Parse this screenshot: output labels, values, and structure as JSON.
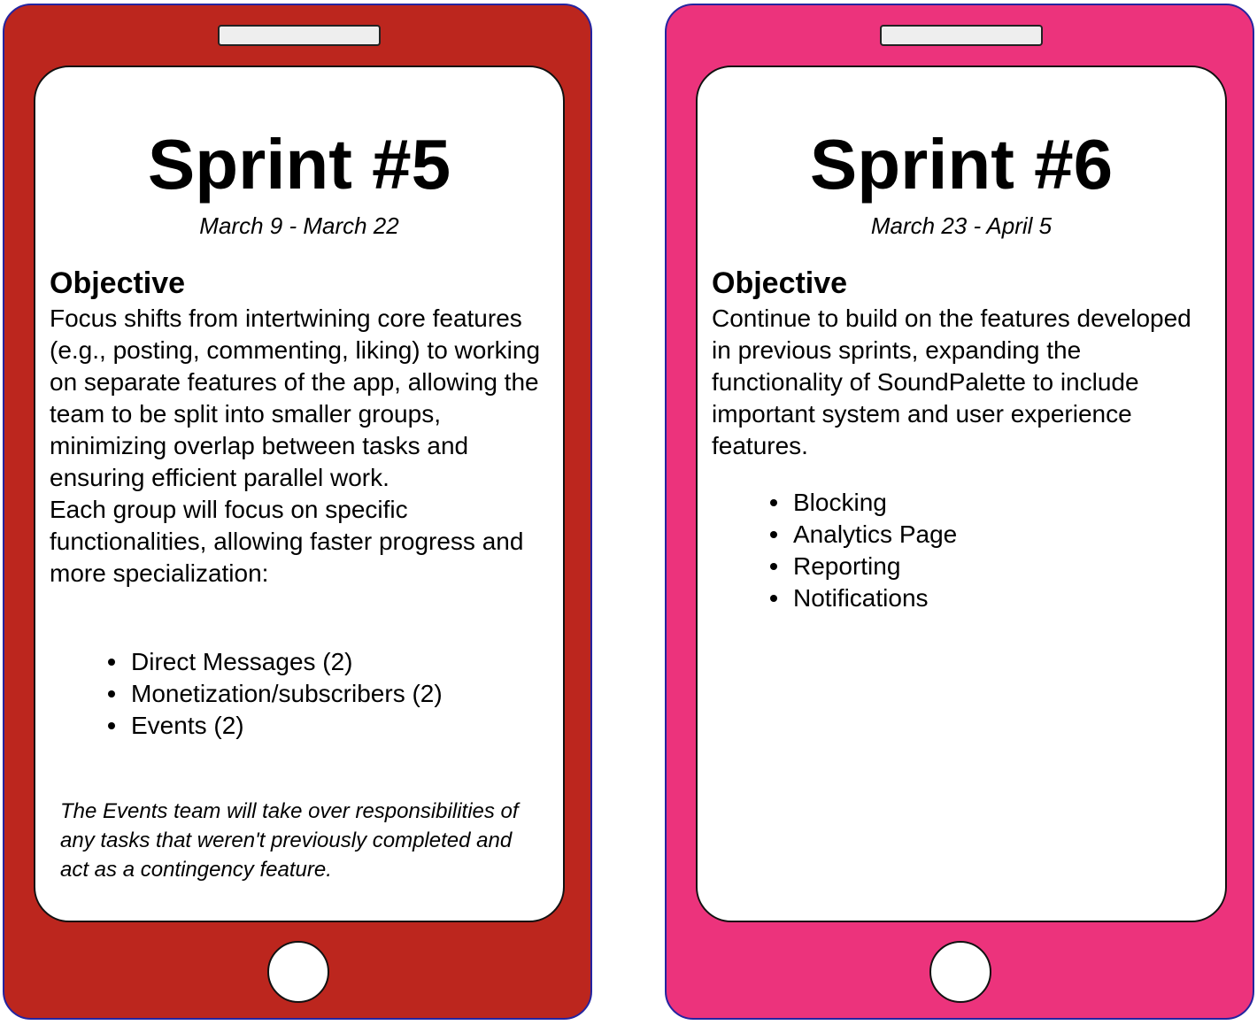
{
  "colors": {
    "sprint5_phone": "#bc261e",
    "sprint6_phone": "#ec337c",
    "phone_border": "#2424a0",
    "screen": "#ffffff",
    "text": "#000000"
  },
  "sprints": [
    {
      "title": "Sprint #5",
      "dates": "March 9 - March 22",
      "objective_heading": "Objective",
      "paragraphs": [
        "Focus shifts from intertwining core features (e.g., posting, commenting, liking) to working on separate features of the app, allowing the team to be split into smaller groups, minimizing overlap between tasks and ensuring efficient parallel work.",
        "Each group will focus on specific functionalities, allowing faster progress and more specialization:"
      ],
      "items": [
        "Direct Messages (2)",
        "Monetization/subscribers (2)",
        "Events (2)"
      ],
      "note": "The Events team will take over responsibilities of any tasks that weren't previously completed and act as a contingency feature."
    },
    {
      "title": "Sprint #6",
      "dates": "March 23 - April 5",
      "objective_heading": "Objective",
      "paragraphs": [
        "Continue to build on the features developed in previous sprints, expanding the functionality of SoundPalette to include important system and user experience features."
      ],
      "items": [
        "Blocking",
        "Analytics Page",
        "Reporting",
        "Notifications"
      ]
    }
  ]
}
